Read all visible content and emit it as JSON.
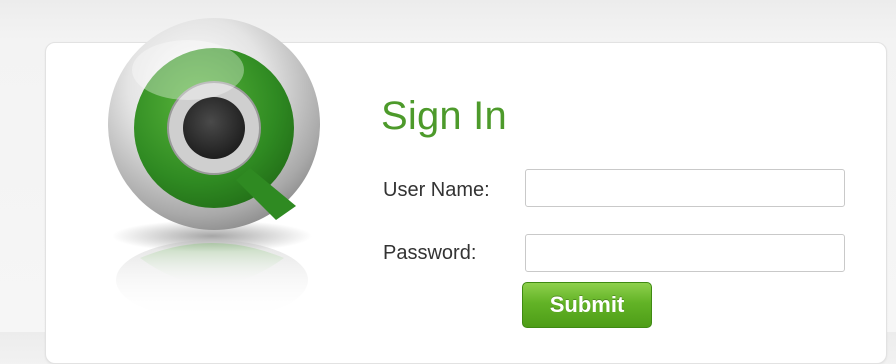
{
  "signin": {
    "title": "Sign In",
    "username_label": "User Name:",
    "username_value": "",
    "password_label": "Password:",
    "password_value": "",
    "submit_label": "Submit"
  },
  "logo": {
    "icon": "qlikview-q-logo-icon"
  },
  "colors": {
    "accent_green": "#4d9a2b",
    "button_green": "#62b326",
    "logo_green": "#3f9a2a"
  }
}
